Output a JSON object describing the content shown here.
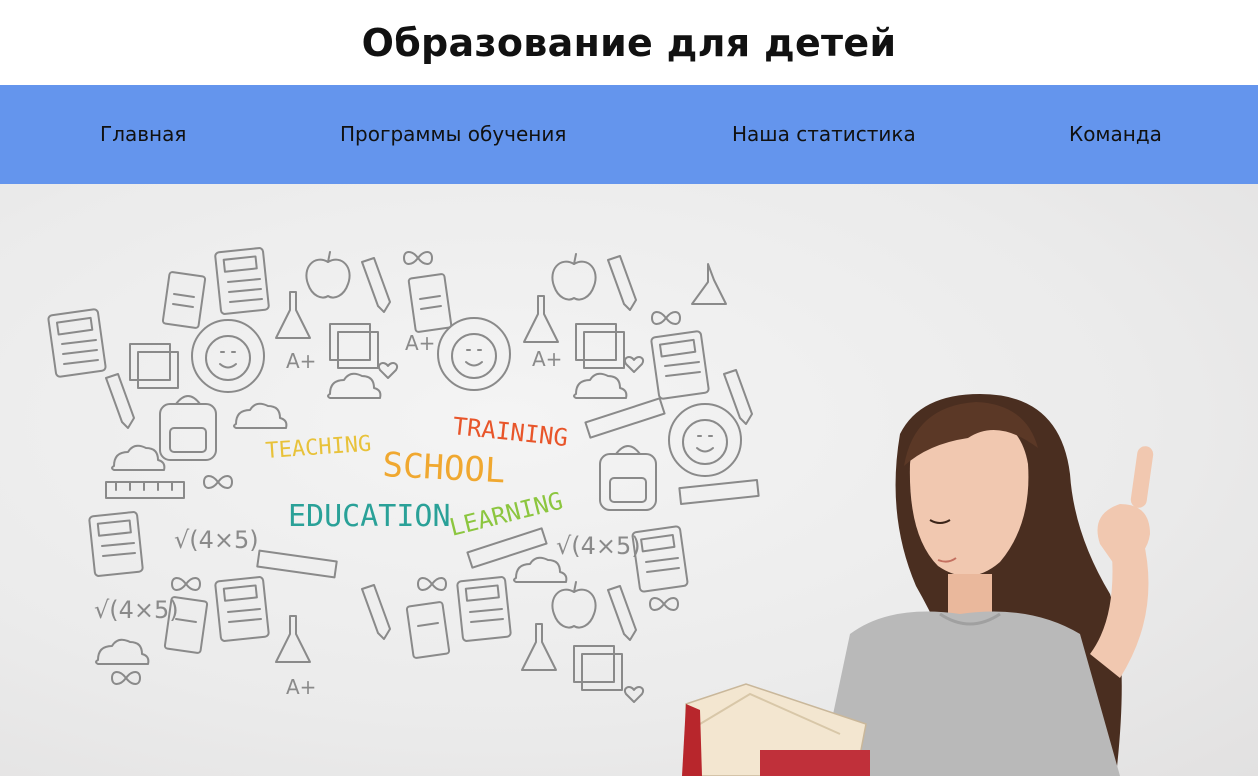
{
  "header": {
    "title": "Образование для детей"
  },
  "nav": {
    "items": [
      {
        "label": "Главная"
      },
      {
        "label": "Программы обучения"
      },
      {
        "label": "Наша статистика"
      },
      {
        "label": "Команда"
      }
    ]
  },
  "hero": {
    "words": {
      "teaching": "TEACHING",
      "school": "SCHOOL",
      "training": "TRAINING",
      "education": "EDUCATION",
      "learning": "LEARNING"
    },
    "doodle_text": {
      "a_plus": "A+",
      "sqrt": "√(4×5)"
    },
    "colors": {
      "teaching": "#e8c23a",
      "school": "#f0a830",
      "training": "#e8552a",
      "education": "#2aa198",
      "learning": "#8cc63f"
    }
  },
  "theme": {
    "nav_bg": "#6495ed",
    "title_color": "#111111"
  }
}
